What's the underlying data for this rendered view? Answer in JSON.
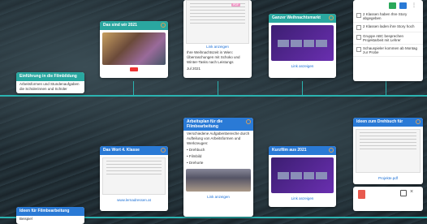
{
  "cards": {
    "c1": {
      "title": "Das sind wir 2021"
    },
    "c2": {
      "bullets": [
        "Ihre Weihnachtszeit in Wien: Überraschungen mit Schoko und Winter-Tasks nach Leistungs",
        "Jul 2021"
      ]
    },
    "c3": {
      "title": "Ganzer Weihnachtsmarkt",
      "link": "Link anzeigen"
    },
    "c5": {
      "title": "Einführung in die Filmbildung",
      "text": "Arbeitsformen und Stundenaufgaben die Schülerinnen und Schüler"
    },
    "c6": {
      "title": "Das Wort 4. Klasse",
      "link": "www.lernadressen.at"
    },
    "c7": {
      "title": "Arbeitsplan für die Filmbearbeitung",
      "text": "Verschiedene Aufgabenbereiche durch Aufteilung von Arbeitsformen und Werkzeugen:",
      "bullets": [
        "Drehbuch",
        "Filmbild",
        "Drehorte"
      ],
      "link": "Link anzeigen"
    },
    "c8": {
      "title": "Kurzfilm aus 2021",
      "link": "Link anzeigen"
    },
    "c9": {
      "title": "Ideen zum Drehbuch für",
      "link": "Projekte.pdf"
    },
    "c10": {
      "title": "Ideen für Filmbearbeitung",
      "text": "Beispiel"
    },
    "c11": {
      "title": "Ideen für Filmbearbeitung"
    }
  },
  "tasks": [
    "2 Klassen haben Ihre Story abgegeben",
    "2 Klassen laden ihre Story hoch",
    "Gruppe ABC besprechen Projektarbeit mit Lehrer",
    "Schauspieler kommen ab Montag zur Probe"
  ],
  "colors": {
    "teal": "#2aa7a0",
    "blue": "#2a7ad6",
    "timeline": "#2bb3b0"
  }
}
